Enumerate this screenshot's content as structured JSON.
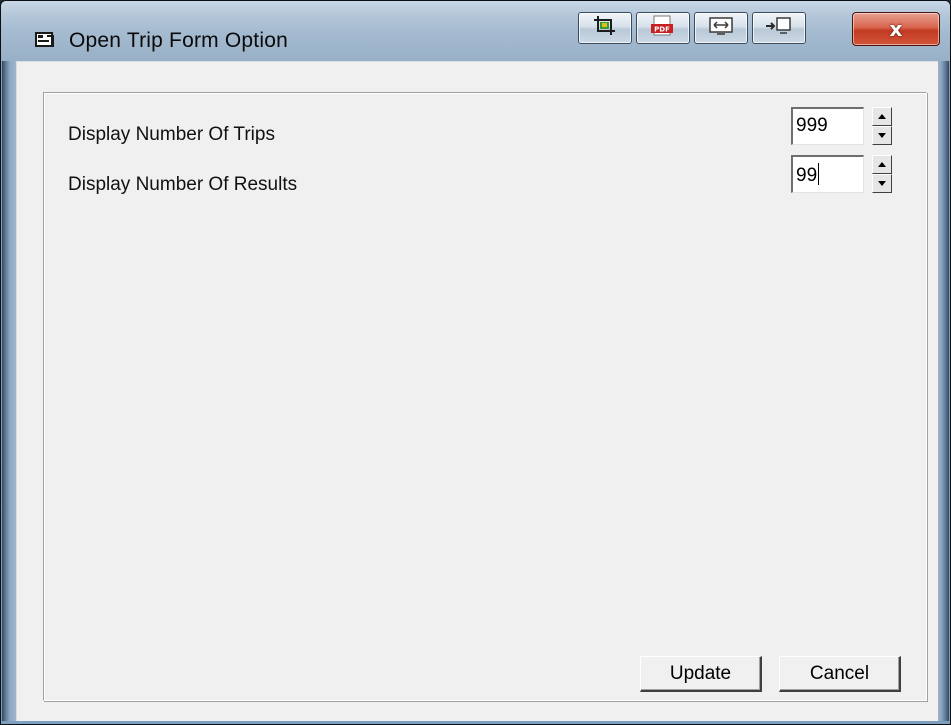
{
  "window": {
    "title": "Open Trip Form Option",
    "title_icon": "form-icon",
    "close_label": "x"
  },
  "toolbar": {
    "buttons": [
      {
        "icon": "crop-icon"
      },
      {
        "icon": "pdf-icon",
        "label": "PDF"
      },
      {
        "icon": "fit-screen-icon"
      },
      {
        "icon": "present-icon"
      }
    ]
  },
  "form": {
    "trips": {
      "label": "Display Number Of Trips",
      "value": "999"
    },
    "results": {
      "label": "Display Number Of Results",
      "value": "99"
    }
  },
  "buttons": {
    "update": "Update",
    "cancel": "Cancel"
  },
  "colors": {
    "close_button": "#c23b22",
    "client_bg": "#f0f0f0",
    "frame": "#8ba3bb"
  }
}
